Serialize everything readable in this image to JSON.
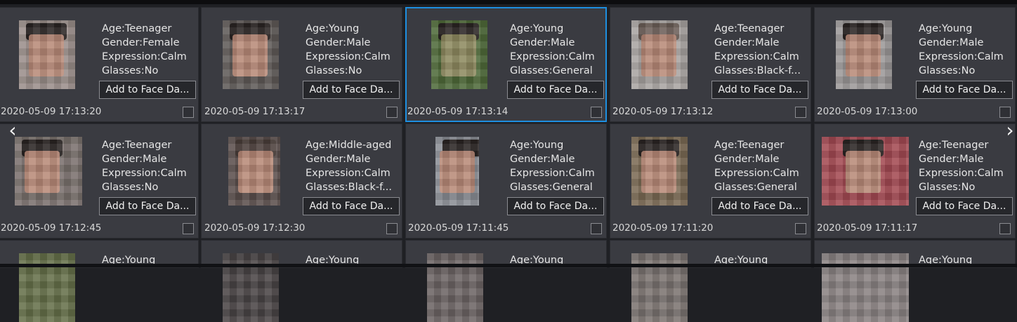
{
  "add_label": "Add to Face Da...",
  "colors": {
    "card_bg": "#3a3b41",
    "selected_border": "#1e8fe0",
    "page_bg": "#1f2024"
  },
  "nav": {
    "prev_icon": "chevron-left-icon",
    "next_icon": "chevron-right-icon"
  },
  "rows": [
    [
      {
        "age": "Age:Teenager",
        "gender": "Gender:Female",
        "expression": "Expression:Calm",
        "glasses": "Glasses:No",
        "time": "2020-05-09 17:13:20"
      },
      {
        "age": "Age:Young",
        "gender": "Gender:Male",
        "expression": "Expression:Calm",
        "glasses": "Glasses:No",
        "time": "2020-05-09 17:13:17"
      },
      {
        "age": "Age:Young",
        "gender": "Gender:Male",
        "expression": "Expression:Calm",
        "glasses": "Glasses:General",
        "time": "2020-05-09 17:13:14"
      },
      {
        "age": "Age:Teenager",
        "gender": "Gender:Male",
        "expression": "Expression:Calm",
        "glasses": "Glasses:Black-f...",
        "time": "2020-05-09 17:13:12"
      },
      {
        "age": "Age:Young",
        "gender": "Gender:Male",
        "expression": "Expression:Calm",
        "glasses": "Glasses:No",
        "time": "2020-05-09 17:13:00"
      }
    ],
    [
      {
        "age": "Age:Teenager",
        "gender": "Gender:Male",
        "expression": "Expression:Calm",
        "glasses": "Glasses:No",
        "time": "2020-05-09 17:12:45"
      },
      {
        "age": "Age:Middle-aged",
        "gender": "Gender:Male",
        "expression": "Expression:Calm",
        "glasses": "Glasses:Black-f...",
        "time": "2020-05-09 17:12:30"
      },
      {
        "age": "Age:Young",
        "gender": "Gender:Male",
        "expression": "Expression:Calm",
        "glasses": "Glasses:General",
        "time": "2020-05-09 17:11:45"
      },
      {
        "age": "Age:Teenager",
        "gender": "Gender:Male",
        "expression": "Expression:Calm",
        "glasses": "Glasses:General",
        "time": "2020-05-09 17:11:20"
      },
      {
        "age": "Age:Teenager",
        "gender": "Gender:Male",
        "expression": "Expression:Calm",
        "glasses": "Glasses:No",
        "time": "2020-05-09 17:11:17"
      }
    ],
    [
      {
        "age": "Age:Young"
      },
      {
        "age": "Age:Young"
      },
      {
        "age": "Age:Young"
      },
      {
        "age": "Age:Young"
      },
      {
        "age": "Age:Young"
      }
    ]
  ]
}
